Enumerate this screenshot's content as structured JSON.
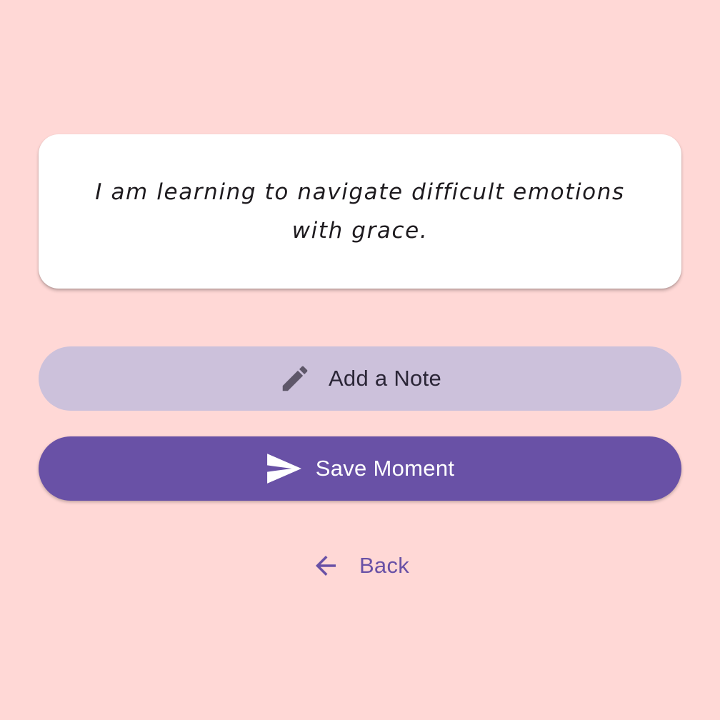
{
  "affirmation": {
    "text": "I am learning to navigate difficult emotions with grace."
  },
  "actions": {
    "add_note": {
      "label": "Add a Note",
      "icon": "pencil-icon"
    },
    "save": {
      "label": "Save Moment",
      "icon": "send-icon"
    },
    "back": {
      "label": "Back",
      "icon": "arrow-left-icon"
    }
  },
  "colors": {
    "background": "#FFD8D6",
    "card": "#FFFFFF",
    "secondary_button": "#CCC1DB",
    "primary_button": "#6951A6",
    "accent": "#6951A6"
  }
}
